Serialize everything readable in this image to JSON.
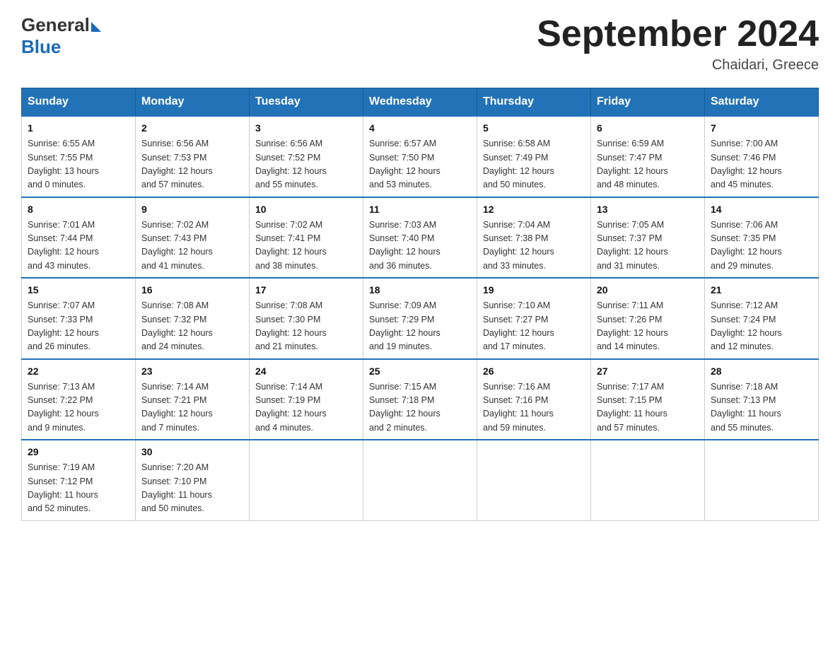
{
  "logo": {
    "general": "General",
    "blue": "Blue"
  },
  "title": "September 2024",
  "location": "Chaidari, Greece",
  "days_of_week": [
    "Sunday",
    "Monday",
    "Tuesday",
    "Wednesday",
    "Thursday",
    "Friday",
    "Saturday"
  ],
  "weeks": [
    [
      {
        "day": "1",
        "sunrise": "6:55 AM",
        "sunset": "7:55 PM",
        "daylight": "13 hours and 0 minutes."
      },
      {
        "day": "2",
        "sunrise": "6:56 AM",
        "sunset": "7:53 PM",
        "daylight": "12 hours and 57 minutes."
      },
      {
        "day": "3",
        "sunrise": "6:56 AM",
        "sunset": "7:52 PM",
        "daylight": "12 hours and 55 minutes."
      },
      {
        "day": "4",
        "sunrise": "6:57 AM",
        "sunset": "7:50 PM",
        "daylight": "12 hours and 53 minutes."
      },
      {
        "day": "5",
        "sunrise": "6:58 AM",
        "sunset": "7:49 PM",
        "daylight": "12 hours and 50 minutes."
      },
      {
        "day": "6",
        "sunrise": "6:59 AM",
        "sunset": "7:47 PM",
        "daylight": "12 hours and 48 minutes."
      },
      {
        "day": "7",
        "sunrise": "7:00 AM",
        "sunset": "7:46 PM",
        "daylight": "12 hours and 45 minutes."
      }
    ],
    [
      {
        "day": "8",
        "sunrise": "7:01 AM",
        "sunset": "7:44 PM",
        "daylight": "12 hours and 43 minutes."
      },
      {
        "day": "9",
        "sunrise": "7:02 AM",
        "sunset": "7:43 PM",
        "daylight": "12 hours and 41 minutes."
      },
      {
        "day": "10",
        "sunrise": "7:02 AM",
        "sunset": "7:41 PM",
        "daylight": "12 hours and 38 minutes."
      },
      {
        "day": "11",
        "sunrise": "7:03 AM",
        "sunset": "7:40 PM",
        "daylight": "12 hours and 36 minutes."
      },
      {
        "day": "12",
        "sunrise": "7:04 AM",
        "sunset": "7:38 PM",
        "daylight": "12 hours and 33 minutes."
      },
      {
        "day": "13",
        "sunrise": "7:05 AM",
        "sunset": "7:37 PM",
        "daylight": "12 hours and 31 minutes."
      },
      {
        "day": "14",
        "sunrise": "7:06 AM",
        "sunset": "7:35 PM",
        "daylight": "12 hours and 29 minutes."
      }
    ],
    [
      {
        "day": "15",
        "sunrise": "7:07 AM",
        "sunset": "7:33 PM",
        "daylight": "12 hours and 26 minutes."
      },
      {
        "day": "16",
        "sunrise": "7:08 AM",
        "sunset": "7:32 PM",
        "daylight": "12 hours and 24 minutes."
      },
      {
        "day": "17",
        "sunrise": "7:08 AM",
        "sunset": "7:30 PM",
        "daylight": "12 hours and 21 minutes."
      },
      {
        "day": "18",
        "sunrise": "7:09 AM",
        "sunset": "7:29 PM",
        "daylight": "12 hours and 19 minutes."
      },
      {
        "day": "19",
        "sunrise": "7:10 AM",
        "sunset": "7:27 PM",
        "daylight": "12 hours and 17 minutes."
      },
      {
        "day": "20",
        "sunrise": "7:11 AM",
        "sunset": "7:26 PM",
        "daylight": "12 hours and 14 minutes."
      },
      {
        "day": "21",
        "sunrise": "7:12 AM",
        "sunset": "7:24 PM",
        "daylight": "12 hours and 12 minutes."
      }
    ],
    [
      {
        "day": "22",
        "sunrise": "7:13 AM",
        "sunset": "7:22 PM",
        "daylight": "12 hours and 9 minutes."
      },
      {
        "day": "23",
        "sunrise": "7:14 AM",
        "sunset": "7:21 PM",
        "daylight": "12 hours and 7 minutes."
      },
      {
        "day": "24",
        "sunrise": "7:14 AM",
        "sunset": "7:19 PM",
        "daylight": "12 hours and 4 minutes."
      },
      {
        "day": "25",
        "sunrise": "7:15 AM",
        "sunset": "7:18 PM",
        "daylight": "12 hours and 2 minutes."
      },
      {
        "day": "26",
        "sunrise": "7:16 AM",
        "sunset": "7:16 PM",
        "daylight": "11 hours and 59 minutes."
      },
      {
        "day": "27",
        "sunrise": "7:17 AM",
        "sunset": "7:15 PM",
        "daylight": "11 hours and 57 minutes."
      },
      {
        "day": "28",
        "sunrise": "7:18 AM",
        "sunset": "7:13 PM",
        "daylight": "11 hours and 55 minutes."
      }
    ],
    [
      {
        "day": "29",
        "sunrise": "7:19 AM",
        "sunset": "7:12 PM",
        "daylight": "11 hours and 52 minutes."
      },
      {
        "day": "30",
        "sunrise": "7:20 AM",
        "sunset": "7:10 PM",
        "daylight": "11 hours and 50 minutes."
      },
      null,
      null,
      null,
      null,
      null
    ]
  ],
  "labels": {
    "sunrise": "Sunrise:",
    "sunset": "Sunset:",
    "daylight": "Daylight:"
  }
}
